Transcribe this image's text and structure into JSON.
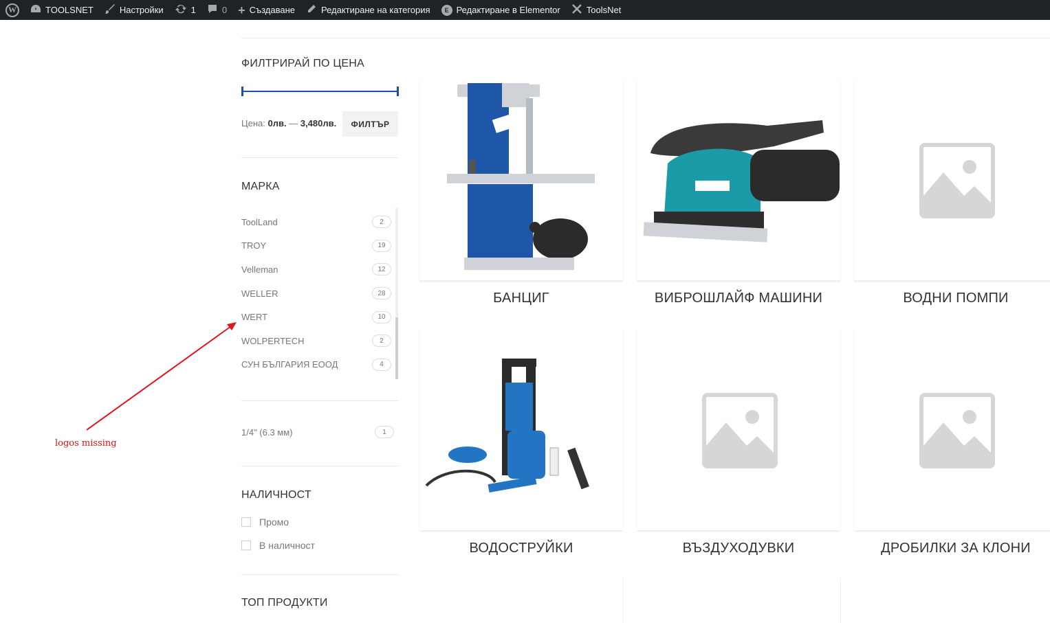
{
  "admin_bar": {
    "site_name": "TOOLSNET",
    "customize": "Настройки",
    "updates_count": "1",
    "comments_count": "0",
    "new": "Създаване",
    "edit_category": "Редактиране на категория",
    "edit_elementor": "Редактиране в Elementor",
    "toolsnet": "ToolsNet"
  },
  "filters": {
    "price": {
      "title": "ФИЛТРИРАЙ ПО ЦЕНА",
      "label": "Цена:",
      "min": "0лв.",
      "separator": "—",
      "max": "3,480лв.",
      "button": "ФИЛТЪР"
    },
    "brand": {
      "title": "МАРКА",
      "items": [
        {
          "name": "ToolLand",
          "count": "2"
        },
        {
          "name": "TROY",
          "count": "19"
        },
        {
          "name": "Velleman",
          "count": "12"
        },
        {
          "name": "WELLER",
          "count": "28"
        },
        {
          "name": "WERT",
          "count": "10"
        },
        {
          "name": "WOLPERTECH",
          "count": "2"
        },
        {
          "name": "СУН БЪЛГАРИЯ ЕООД",
          "count": "4"
        }
      ]
    },
    "size": {
      "items": [
        {
          "name": "1/4\" (6.3 мм)",
          "count": "1"
        }
      ]
    },
    "availability": {
      "title": "НАЛИЧНОСТ",
      "options": [
        "Промо",
        "В наличност"
      ]
    },
    "top_products": {
      "title": "ТОП ПРОДУКТИ"
    }
  },
  "annotation": {
    "text": "logos missing",
    "color": "#d01515"
  },
  "products": [
    {
      "title": "БАНЦИГ",
      "image": "bandsaw-image"
    },
    {
      "title": "ВИБРОШЛАЙФ МАШИНИ",
      "image": "orbital-sander-image"
    },
    {
      "title": "ВОДНИ ПОМПИ",
      "image": "placeholder-image"
    },
    {
      "title": "ВОДОСТРУЙКИ",
      "image": "pressure-washer-image"
    },
    {
      "title": "ВЪЗДУХОДУВКИ",
      "image": "placeholder-image"
    },
    {
      "title": "ДРОБИЛКИ ЗА КЛОНИ",
      "image": "placeholder-image"
    }
  ],
  "colors": {
    "admin_bar": "#1d2327",
    "slider": "#1e4fa8",
    "annotation": "#d01515"
  }
}
